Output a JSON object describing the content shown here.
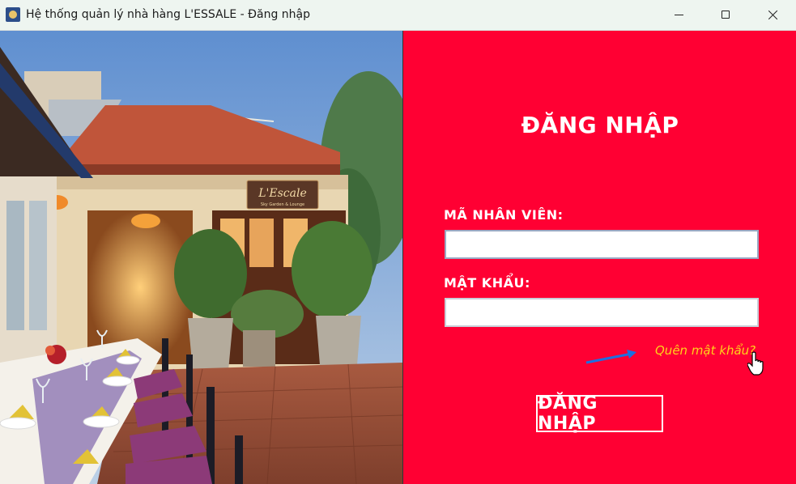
{
  "window": {
    "title": "Hệ thống quản lý nhà hàng L'ESSALE - Đăng nhập",
    "icon": "app-icon",
    "controls": [
      "minimize-icon",
      "maximize-icon",
      "close-icon"
    ]
  },
  "photo": {
    "sign_text": "L'Escale",
    "sign_subtext": "Sky Garden & Lounge"
  },
  "form": {
    "heading": "ĐĂNG NHẬP",
    "employee_label": "MÃ NHÂN VIÊN:",
    "employee_value": "",
    "password_label": "MẬT KHẨU:",
    "password_value": "",
    "forgot_link": "Quên mật khẩu?",
    "login_button": "ĐĂNG NHẬP"
  },
  "colors": {
    "panel_background": "#ff0033",
    "forgot_link": "#ffd21a",
    "annotation_arrow": "#1e6fe0"
  }
}
